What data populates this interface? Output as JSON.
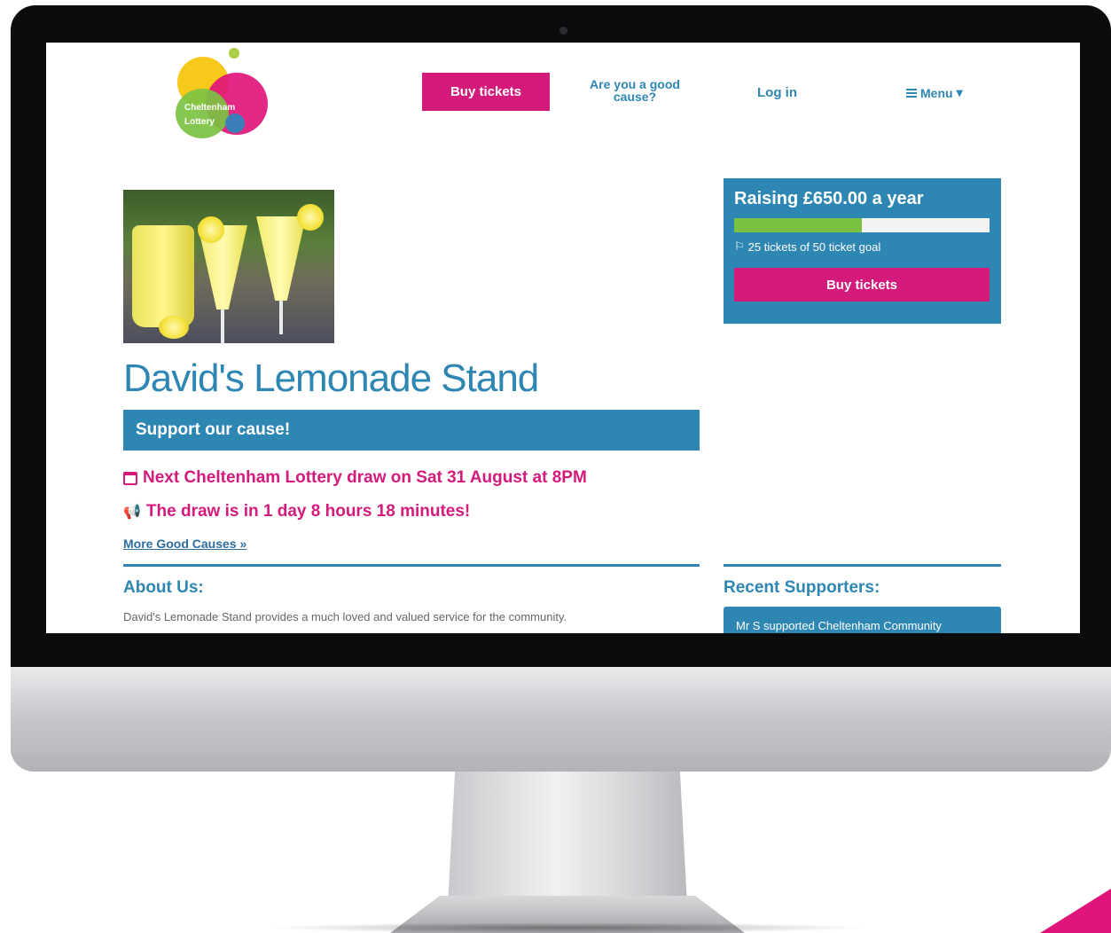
{
  "nav": {
    "logo_line1": "Cheltenham",
    "logo_line2": "Lottery",
    "buy_label": "Buy tickets",
    "cause_label": "Are you a good cause?",
    "login_label": "Log in",
    "menu_label": "Menu"
  },
  "cause": {
    "title": "David's Lemonade Stand",
    "support_label": "Support our cause!",
    "draw_text": "Next Cheltenham Lottery draw on Sat 31 August at 8PM",
    "countdown_text": "The draw is in 1 day 8 hours 18 minutes!",
    "more_link": "More Good Causes »",
    "about_heading": "About Us:",
    "about_text": "David's Lemonade Stand provides a much loved and valued service for the community."
  },
  "sidebar": {
    "raising_text": "Raising £650.00 a year",
    "progress_fraction": 0.5,
    "goal_text": "25 tickets of 50 ticket goal",
    "buy_label": "Buy tickets",
    "supporters_heading": "Recent Supporters:",
    "supporters": [
      "Mr S supported Cheltenham Community"
    ]
  },
  "colors": {
    "accent_blue": "#2e86b3",
    "accent_pink": "#d41b7c",
    "progress_green": "#7cc242"
  }
}
